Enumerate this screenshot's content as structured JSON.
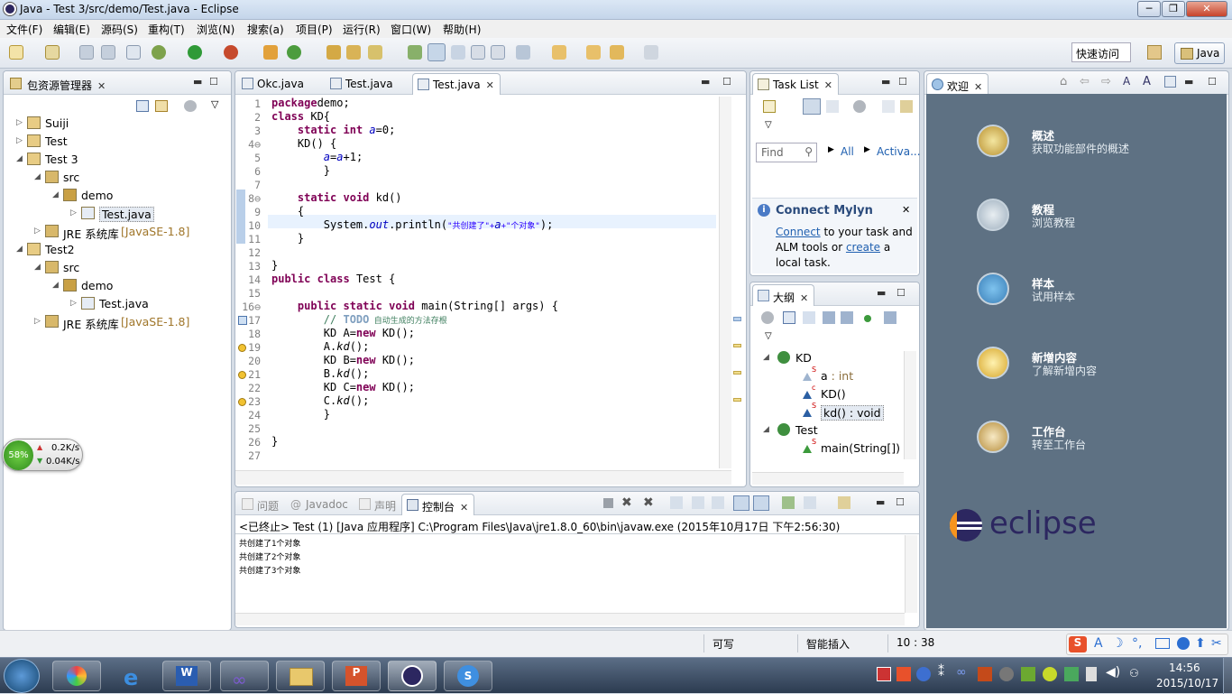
{
  "window": {
    "title": "Java - Test 3/src/demo/Test.java - Eclipse"
  },
  "menu": [
    "文件(F)",
    "编辑(E)",
    "源码(S)",
    "重构(T)",
    "浏览(N)",
    "搜索(a)",
    "项目(P)",
    "运行(R)",
    "窗口(W)",
    "帮助(H)"
  ],
  "toolbar": {
    "quick_access": "快速访问",
    "perspective": "Java"
  },
  "package_explorer": {
    "tab": "包资源管理器",
    "tree": [
      {
        "label": "Suiji",
        "level": 0,
        "expand": "▷"
      },
      {
        "label": "Test",
        "level": 0,
        "expand": "▷"
      },
      {
        "label": "Test 3",
        "level": 0,
        "expand": "◢"
      },
      {
        "label": "src",
        "level": 1,
        "expand": "◢"
      },
      {
        "label": "demo",
        "level": 2,
        "expand": "◢"
      },
      {
        "label": "Test.java",
        "level": 3,
        "expand": "▷"
      },
      {
        "label": "JRE 系统库",
        "extra": "[JavaSE-1.8]",
        "level": 1,
        "expand": "▷"
      },
      {
        "label": "Test2",
        "level": 0,
        "expand": "◢"
      },
      {
        "label": "src",
        "level": 1,
        "expand": "◢"
      },
      {
        "label": "demo",
        "level": 2,
        "expand": "◢"
      },
      {
        "label": "Test.java",
        "level": 3,
        "expand": "▷"
      },
      {
        "label": "JRE 系统库",
        "extra": "[JavaSE-1.8]",
        "level": 1,
        "expand": "▷"
      }
    ]
  },
  "editor": {
    "tabs": [
      "Okc.java",
      "Test.java",
      "Test.java"
    ],
    "active_tab": 2,
    "line_numbers": [
      "1",
      "2",
      "3",
      "4⊖",
      "5",
      "6",
      "7",
      "8⊖",
      "9",
      "10",
      "11",
      "12",
      "13",
      "14",
      "15",
      "16⊖",
      "17",
      "18",
      "19",
      "20",
      "21",
      "22",
      "23",
      "24",
      "25",
      "26",
      "27"
    ],
    "lines": [
      [
        [
          "kw",
          "package"
        ],
        [
          "",
          "demo;"
        ]
      ],
      [
        [
          "kw",
          "class"
        ],
        [
          "",
          " KD{"
        ]
      ],
      [
        [
          "",
          "    "
        ],
        [
          "kw",
          "static"
        ],
        [
          "",
          " "
        ],
        [
          "kw",
          "int"
        ],
        [
          "",
          " "
        ],
        [
          "fld",
          "a"
        ],
        [
          "",
          "=0;"
        ]
      ],
      [
        [
          "",
          "    KD() {"
        ]
      ],
      [
        [
          "",
          "        "
        ],
        [
          "fld",
          "a"
        ],
        [
          "",
          "="
        ],
        [
          "fld",
          "a"
        ],
        [
          "",
          "+1;"
        ]
      ],
      [
        [
          "",
          "        }"
        ]
      ],
      [
        [
          "",
          ""
        ]
      ],
      [
        [
          "",
          "    "
        ],
        [
          "kw",
          "static"
        ],
        [
          "",
          " "
        ],
        [
          "kw",
          "void"
        ],
        [
          "",
          " kd()"
        ]
      ],
      [
        [
          "",
          "    {"
        ]
      ],
      [
        [
          "",
          "        System."
        ],
        [
          "fld",
          "out"
        ],
        [
          "",
          ".println("
        ],
        [
          "str",
          "\"共创建了\"+"
        ],
        [
          "fld",
          "a"
        ],
        [
          "str",
          "+\"个对象\""
        ],
        [
          "",
          ");"
        ]
      ],
      [
        [
          "",
          "    }"
        ]
      ],
      [
        [
          "",
          ""
        ]
      ],
      [
        [
          "",
          "}"
        ]
      ],
      [
        [
          "kw",
          "public"
        ],
        [
          "",
          " "
        ],
        [
          "kw",
          "class"
        ],
        [
          "",
          " Test {"
        ]
      ],
      [
        [
          "",
          ""
        ]
      ],
      [
        [
          "",
          "    "
        ],
        [
          "kw",
          "public"
        ],
        [
          "",
          " "
        ],
        [
          "kw",
          "static"
        ],
        [
          "",
          " "
        ],
        [
          "kw",
          "void"
        ],
        [
          "",
          " main(String[] args) {"
        ]
      ],
      [
        [
          "",
          "        "
        ],
        [
          "cm",
          "// "
        ],
        [
          "todo",
          "TODO"
        ],
        [
          "cm",
          " 自动生成的方法存根"
        ]
      ],
      [
        [
          "",
          "        KD A="
        ],
        [
          "kw",
          "new"
        ],
        [
          "",
          " KD();"
        ]
      ],
      [
        [
          "",
          "        A."
        ],
        [
          "itl",
          "kd"
        ],
        [
          "",
          "();"
        ]
      ],
      [
        [
          "",
          "        KD B="
        ],
        [
          "kw",
          "new"
        ],
        [
          "",
          " KD();"
        ]
      ],
      [
        [
          "",
          "        B."
        ],
        [
          "itl",
          "kd"
        ],
        [
          "",
          "();"
        ]
      ],
      [
        [
          "",
          "        KD C="
        ],
        [
          "kw",
          "new"
        ],
        [
          "",
          " KD();"
        ]
      ],
      [
        [
          "",
          "        C."
        ],
        [
          "itl",
          "kd"
        ],
        [
          "",
          "();"
        ]
      ],
      [
        [
          "",
          "        }"
        ]
      ],
      [
        [
          "",
          ""
        ]
      ],
      [
        [
          "",
          "}"
        ]
      ],
      [
        [
          "",
          ""
        ]
      ]
    ]
  },
  "task_list": {
    "tab": "Task List",
    "find_placeholder": "Find",
    "all": "All",
    "activate": "Activa...",
    "mylyn_title": "Connect Mylyn",
    "mylyn_connect": "Connect",
    "mylyn_text1": " to your task and",
    "mylyn_text2": "ALM tools or ",
    "mylyn_create": "create",
    "mylyn_text3": " a",
    "mylyn_text4": "local task."
  },
  "outline": {
    "tab": "大纲",
    "items": [
      {
        "label": "KD",
        "level": 0,
        "sup": ""
      },
      {
        "label": "a",
        "type": " : int",
        "level": 1,
        "sup": "S"
      },
      {
        "label": "KD()",
        "type": "",
        "level": 1,
        "sup": "c"
      },
      {
        "label": "kd()",
        "type": " : void",
        "level": 1,
        "sup": "S"
      },
      {
        "label": "Test",
        "level": 0,
        "sup": ""
      },
      {
        "label": "main(String[]) :",
        "type": "",
        "level": 1,
        "sup": "S"
      }
    ]
  },
  "welcome": {
    "tab": "欢迎",
    "items": [
      {
        "title": "概述",
        "sub": "获取功能部件的概述",
        "icon": "globe-icon"
      },
      {
        "title": "教程",
        "sub": "浏览教程",
        "icon": "checklist-icon"
      },
      {
        "title": "样本",
        "sub": "试用样本",
        "icon": "samples-icon"
      },
      {
        "title": "新增内容",
        "sub": "了解新增内容",
        "icon": "star-icon"
      },
      {
        "title": "工作台",
        "sub": "转至工作台",
        "icon": "workbench-icon"
      }
    ],
    "logo_text": "eclipse"
  },
  "console": {
    "tabs": [
      "问题",
      "Javadoc",
      "声明",
      "控制台"
    ],
    "header": "<已终止> Test (1) [Java 应用程序] C:\\Program Files\\Java\\jre1.8.0_60\\bin\\javaw.exe (2015年10月17日 下午2:56:30)",
    "output": [
      "共创建了1个对象",
      "共创建了2个对象",
      "共创建了3个对象"
    ]
  },
  "status": {
    "writable": "可写",
    "insert_mode": "智能插入",
    "position": "10 : 38"
  },
  "net_widget": {
    "percent": "58%",
    "up": "0.2K/s",
    "down": "0.04K/s"
  },
  "taskbar": {
    "time": "14:56",
    "date": "2015/10/17"
  },
  "colors": {
    "keyword": "#7f0055",
    "field": "#0000c0",
    "string": "#2a00ff",
    "comment": "#3f7f5f",
    "welcome_bg": "#5e7183"
  }
}
